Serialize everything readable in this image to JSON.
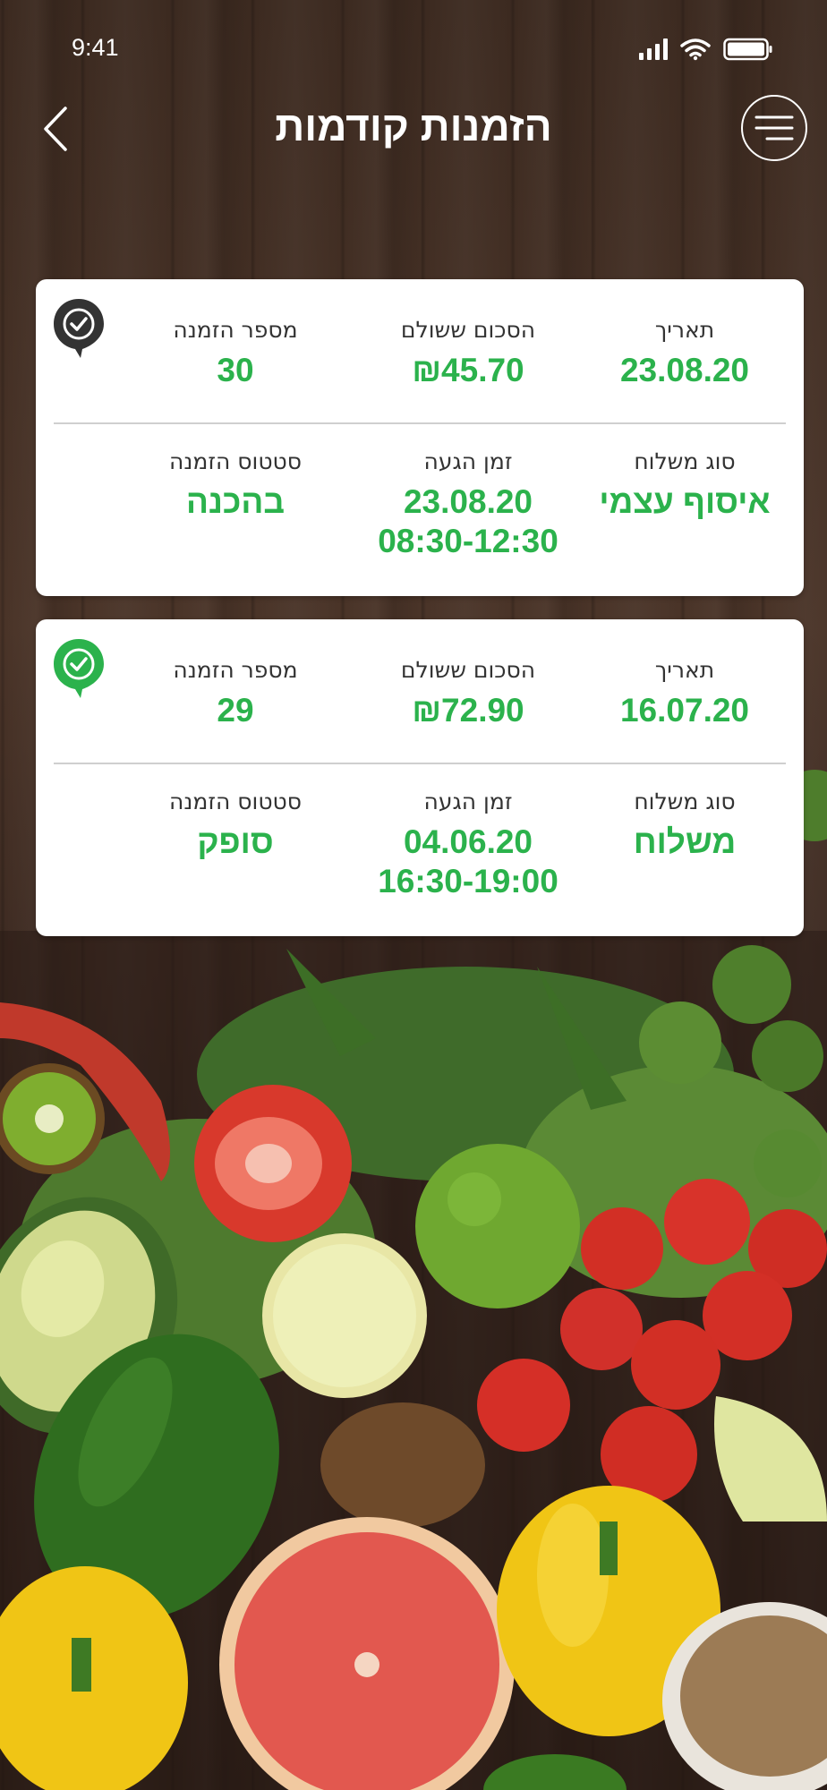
{
  "status_bar": {
    "time": "9:41"
  },
  "header": {
    "title": "הזמנות קודמות",
    "back_icon": "chevron-left-icon",
    "menu_icon": "hamburger-menu-icon"
  },
  "labels": {
    "date": "תאריך",
    "amount_paid": "הסכום ששולם",
    "order_number": "מספר הזמנה",
    "delivery_type": "סוג משלוח",
    "arrival_time": "זמן הגעה",
    "order_status": "סטטוס הזמנה"
  },
  "orders": [
    {
      "date": "23.08.20",
      "amount": "₪45.70",
      "order_number": "30",
      "delivery_type": "איסוף עצמי",
      "arrival_date": "23.08.20",
      "arrival_window": "08:30-12:30",
      "status": "בהכנה",
      "status_icon": "check-pin-icon",
      "status_color": "#333333"
    },
    {
      "date": "16.07.20",
      "amount": "₪72.90",
      "order_number": "29",
      "delivery_type": "משלוח",
      "arrival_date": "04.06.20",
      "arrival_window": "16:30-19:00",
      "status": "סופק",
      "status_icon": "check-pin-icon",
      "status_color": "#2bb24c"
    }
  ],
  "colors": {
    "accent_green": "#2bb24c",
    "card_bg": "#ffffff",
    "wood_dark": "#3c2a20"
  }
}
